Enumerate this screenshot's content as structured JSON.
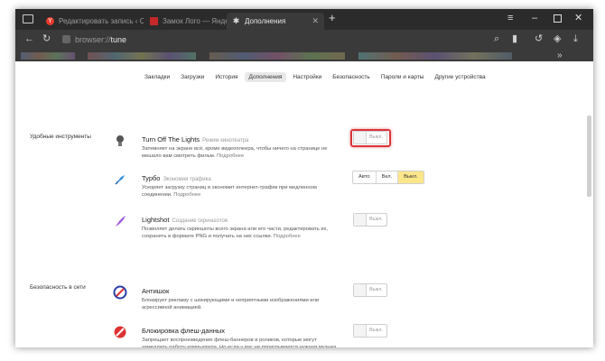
{
  "tabs": [
    {
      "label": "Редактировать запись ‹ Сі",
      "icon": "yandex-icon"
    },
    {
      "label": "Замок Лого — Яндекс.ма",
      "icon": "red-square-icon"
    },
    {
      "label": "Дополнения",
      "icon": "puzzle-icon"
    }
  ],
  "address": {
    "scheme": "browser://",
    "path": "tune"
  },
  "settings_nav": [
    "Закладки",
    "Загрузки",
    "История",
    "Дополнения",
    "Настройки",
    "Безопасность",
    "Пароли и карты",
    "Другие устройства"
  ],
  "settings_nav_active": "Дополнения",
  "sections": {
    "convenient": "Удобные инструменты",
    "security": "Безопасность в сети"
  },
  "extensions": [
    {
      "name": "Turn Off The Lights",
      "subtitle": "Режим кинотеатра",
      "description": "Затемняет на экране всё, кроме видеоплеера, чтобы ничего на странице не мешало вам смотреть фильм.",
      "more": "Подробнее",
      "toggle": "Выкл.",
      "icon": "bulb-icon"
    },
    {
      "name": "Турбо",
      "subtitle": "Экономия трафика",
      "description": "Ускоряет загрузку страниц и экономит интернет-трафик при медленном соединении.",
      "more": "Подробнее",
      "options": [
        "Авто",
        "Вкл.",
        "Выкл."
      ],
      "selected": "Выкл.",
      "icon": "rocket-icon"
    },
    {
      "name": "Lightshot",
      "subtitle": "Создание скриншотов",
      "description": "Позволяет делать скриншоты всего экрана или его части, редактировать их, сохранять в формате PNG и получать на них ссылки.",
      "more": "Подробнее",
      "toggle": "Выкл.",
      "icon": "feather-icon"
    },
    {
      "name": "Антишок",
      "subtitle": "",
      "description": "Блокирует рекламу с шокирующими и неприятными изображениями или агрессивной анимацией.",
      "more": "",
      "toggle": "Выкл.",
      "icon": "antishock-icon"
    },
    {
      "name": "Блокировка флеш-данных",
      "subtitle": "",
      "description": "Запрещает воспроизведение флеш-баннеров и роликов, которые могут замедлить работу компьютера. Но если у вас не проигрывается нужная музыка",
      "more": "",
      "toggle": "Выкл.",
      "icon": "flash-block-icon"
    }
  ],
  "colors": {
    "highlight": "#d9363a",
    "turbo_selected": "#fce68a"
  }
}
